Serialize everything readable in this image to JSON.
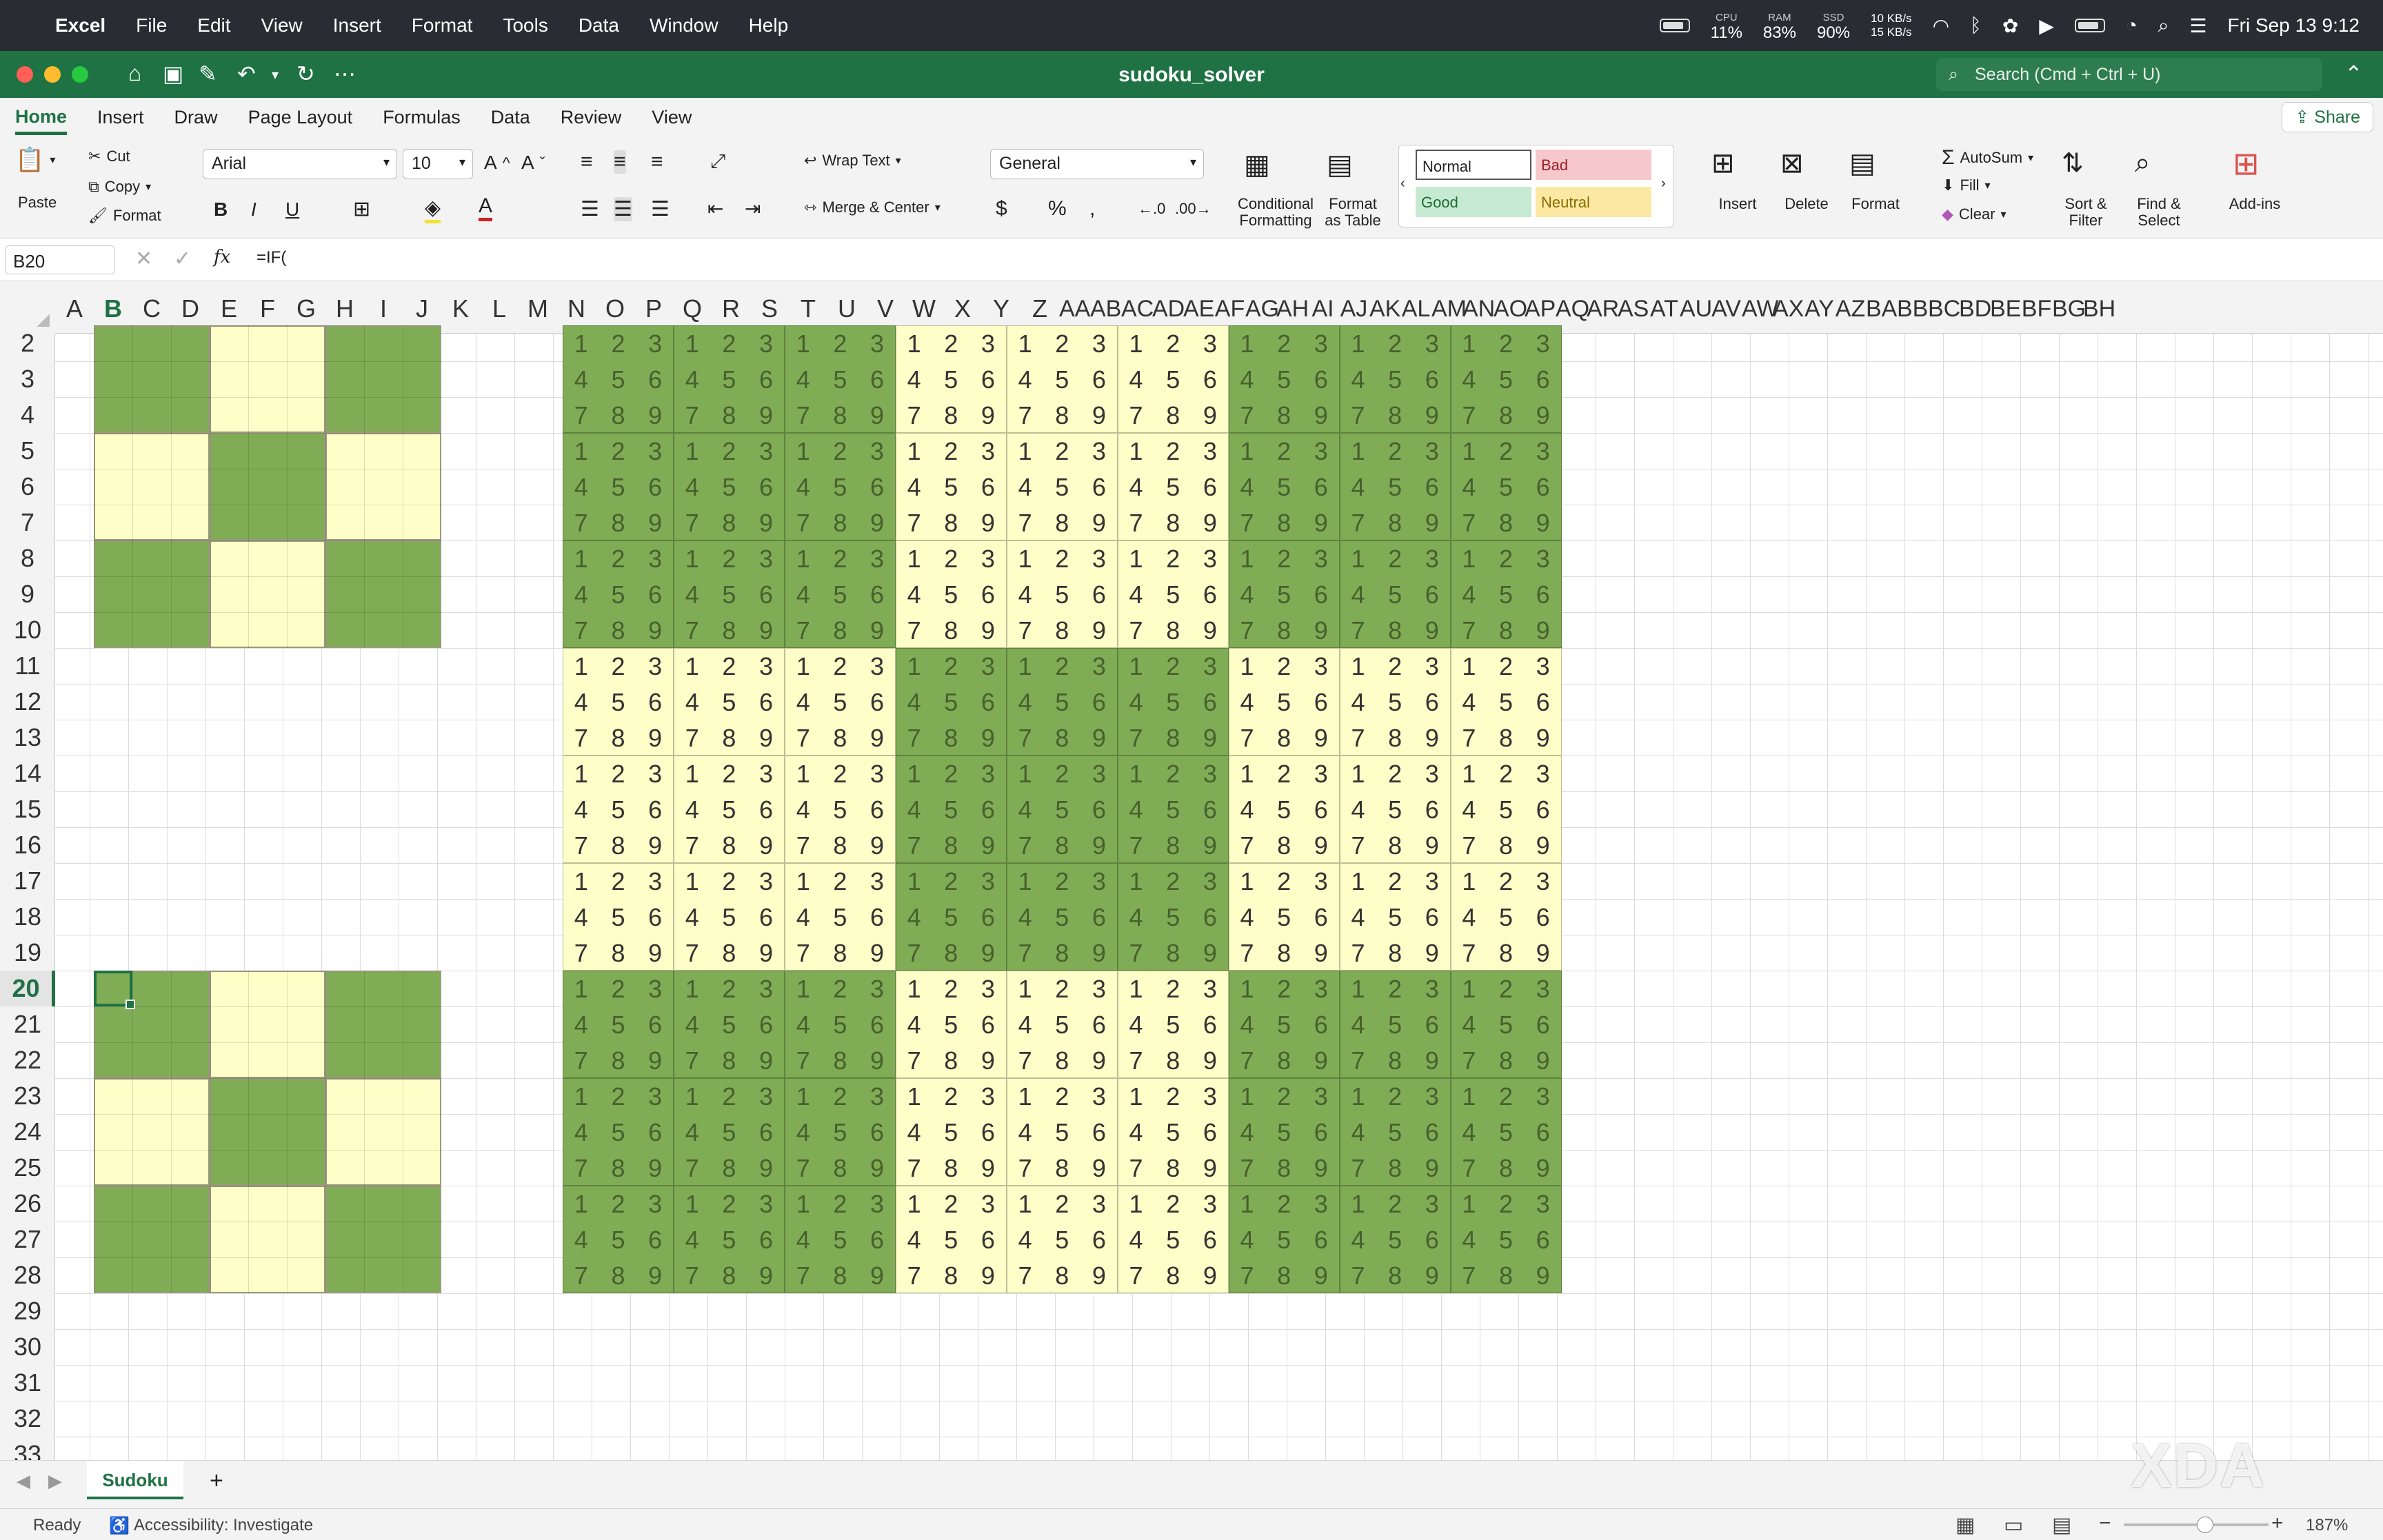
{
  "menubar": {
    "app": "Excel",
    "items": [
      "File",
      "Edit",
      "View",
      "Insert",
      "Format",
      "Tools",
      "Data",
      "Window",
      "Help"
    ],
    "cpu": {
      "label": "CPU",
      "value": "11%"
    },
    "ram": {
      "label": "RAM",
      "value": "83%"
    },
    "ssd": {
      "label": "SSD",
      "value": "90%"
    },
    "net_up": "10 KB/s",
    "net_down": "15 KB/s",
    "datetime": "Fri Sep 13  9:12"
  },
  "titlebar": {
    "title": "sudoku_solver",
    "search_placeholder": "Search (Cmd + Ctrl + U)"
  },
  "tabs": [
    "Home",
    "Insert",
    "Draw",
    "Page Layout",
    "Formulas",
    "Data",
    "Review",
    "View"
  ],
  "share_label": "Share",
  "ribbon": {
    "paste": "Paste",
    "cut": "Cut",
    "copy": "Copy",
    "format_painter": "Format",
    "font": "Arial",
    "size": "10",
    "bold": "B",
    "italic": "I",
    "underline": "U",
    "wrap_text": "Wrap Text",
    "merge_center": "Merge & Center",
    "number_format": "General",
    "cond_fmt_1": "Conditional",
    "cond_fmt_2": "Formatting",
    "fmt_table_1": "Format",
    "fmt_table_2": "as Table",
    "styles": {
      "normal": "Normal",
      "bad": "Bad",
      "good": "Good",
      "neutral": "Neutral"
    },
    "insert": "Insert",
    "delete": "Delete",
    "format": "Format",
    "autosum": "AutoSum",
    "fill": "Fill",
    "clear": "Clear",
    "sort_1": "Sort &",
    "sort_2": "Filter",
    "find_1": "Find &",
    "find_2": "Select",
    "addins": "Add-ins"
  },
  "formula_bar": {
    "name_box": "B20",
    "fx": "fx",
    "formula": "=IF("
  },
  "columns": [
    "A",
    "B",
    "C",
    "D",
    "E",
    "F",
    "G",
    "H",
    "I",
    "J",
    "K",
    "L",
    "M",
    "N",
    "O",
    "P",
    "Q",
    "R",
    "S",
    "T",
    "U",
    "V",
    "W",
    "X",
    "Y",
    "Z",
    "AA",
    "AB",
    "AC",
    "AD",
    "AE",
    "AF",
    "AG",
    "AH",
    "AI",
    "AJ",
    "AK",
    "AL",
    "AM",
    "AN",
    "AO",
    "AP",
    "AQ",
    "AR",
    "AS",
    "AT",
    "AU",
    "AV",
    "AW",
    "AX",
    "AY",
    "AZ",
    "BA",
    "BB",
    "BC",
    "BD",
    "BE",
    "BF",
    "BG",
    "BH"
  ],
  "active_column": "B",
  "rows": [
    "2",
    "3",
    "4",
    "5",
    "6",
    "7",
    "8",
    "9",
    "10",
    "11",
    "12",
    "13",
    "14",
    "15",
    "16",
    "17",
    "18",
    "19",
    "20",
    "21",
    "22",
    "23",
    "24",
    "25",
    "26",
    "27",
    "28",
    "29",
    "30",
    "31",
    "32",
    "33"
  ],
  "active_row": "20",
  "candidate_digits": [
    "1",
    "2",
    "3",
    "4",
    "5",
    "6",
    "7",
    "8",
    "9"
  ],
  "colors": {
    "green": "#7fac55",
    "yellow": "#fefec8",
    "accent": "#1f7244"
  },
  "sheet_tab": "Sudoku",
  "add_sheet": "+",
  "status": {
    "ready": "Ready",
    "accessibility": "Accessibility: Investigate",
    "zoom": "187%"
  },
  "watermark": "XDA"
}
